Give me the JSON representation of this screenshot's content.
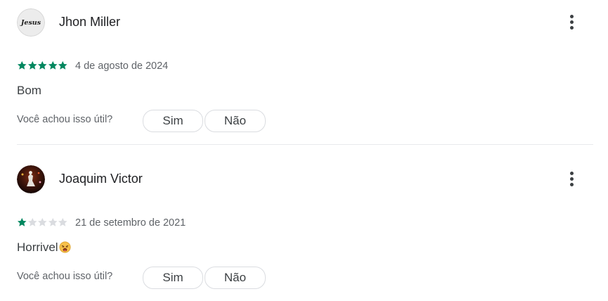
{
  "reviews": [
    {
      "author": "Jhon Miller",
      "avatar_text": "Jesus",
      "rating": 5,
      "max_rating": 5,
      "date": "4 de agosto de 2024",
      "text": "Bom",
      "emoji": "",
      "helpful_question": "Você achou isso útil?",
      "yes_label": "Sim",
      "no_label": "Não"
    },
    {
      "author": "Joaquim Victor",
      "avatar_text": "",
      "rating": 1,
      "max_rating": 5,
      "date": "21 de setembro de 2021",
      "text": "Horrivel",
      "emoji": "weary-face",
      "helpful_question": "Você achou isso útil?",
      "yes_label": "Sim",
      "no_label": "Não"
    }
  ],
  "icons": {
    "more": "more-vert-icon",
    "star": "star-icon"
  },
  "colors": {
    "star_filled": "#01875f",
    "star_empty": "#dadce0",
    "text_secondary": "#5f6368",
    "divider": "#e8eaed"
  }
}
